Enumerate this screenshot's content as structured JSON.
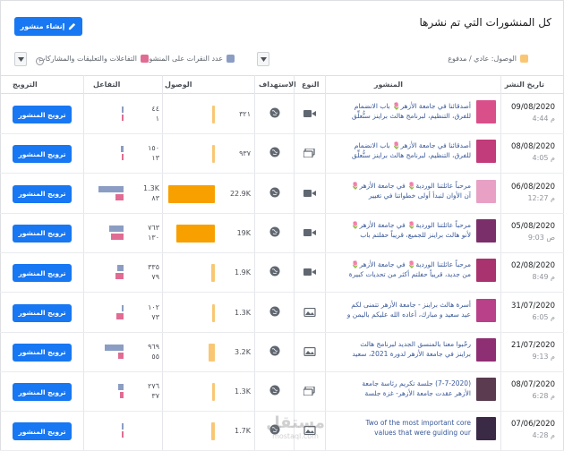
{
  "header": {
    "title": "كل المنشورات التي تم نشرها",
    "create_button": "إنشاء منشور"
  },
  "legend": {
    "reach_label": "الوصول: عادي / مدفوع",
    "clicks_label": "عدد النقرات على المنشور",
    "reactions_label": "التفاعلات والتعليقات والمشاركات",
    "reach_color": "#f7b928",
    "clicks_color": "#8b9dc3",
    "reactions_color": "#e06c93"
  },
  "columns": {
    "date": "تاريخ النشر",
    "post": "المنشور",
    "type": "النوع",
    "targeting": "الاستهداف",
    "reach": "الوصول",
    "engagement": "التفاعل",
    "promote": "الترويج"
  },
  "rows": [
    {
      "date": "09/08/2020",
      "time": "4:44 م",
      "text": "أصدقائنا في جامعة الأزهر🌷 باب الانضمام للفرق، التنظيم، لبرنامج هالث براينز سنُّعلِّق",
      "type": "video",
      "reach": "٣٢١",
      "reach_value": 321,
      "paid_value": 0,
      "clicks": "٤٤",
      "reactions": "١",
      "clicks_value": 44,
      "reactions_value": 1,
      "thumb_color": "#d94f8a",
      "promote": "ترويج المنشور"
    },
    {
      "date": "08/08/2020",
      "time": "4:05 م",
      "text": "أصدقائنا في جامعة الأزهر🌷 باب الانضمام للفرق، التنظيم، لبرنامج هالث براينز سنُّعلِّق",
      "type": "album",
      "reach": "٩٣٧",
      "reach_value": 937,
      "paid_value": 0,
      "clicks": "١٥٠",
      "reactions": "١٣",
      "clicks_value": 150,
      "reactions_value": 13,
      "thumb_color": "#c23b7a",
      "promote": "ترويج المنشور"
    },
    {
      "date": "06/08/2020",
      "time": "12:27 م",
      "text": "مرحباً عائلتنا الوردية🌷 في جامعة الأزهر🌷 آن الأوان لنبدأ أولى خطواتنا في تغيير المجتمع نحو",
      "type": "video",
      "reach": "22.9K",
      "reach_value": 22900,
      "paid_value": 0,
      "clicks": "1.3K",
      "reactions": "٨٣",
      "clicks_value": 1300,
      "reactions_value": 83,
      "thumb_color": "#e8a1c4",
      "promote": "ترويج المنشور"
    },
    {
      "date": "05/08/2020",
      "time": "9:03 ص",
      "text": "مرحباً عائلتنا الوردية🌷 في جامعة الأزهر🌷 لأنو هالث براينز للجميع، قريباً حفلتم باب الانضمام",
      "type": "video",
      "reach": "19K",
      "reach_value": 19000,
      "paid_value": 0,
      "clicks": "٧٦٣",
      "reactions": "١٣٠",
      "clicks_value": 763,
      "reactions_value": 130,
      "thumb_color": "#7a2f6b",
      "promote": "ترويج المنشور"
    },
    {
      "date": "02/08/2020",
      "time": "8:49 م",
      "text": "مرحباً عائلتنا الوردية🌷 في جامعة الأزهر🌷 من جديد، قريباً حفلتم أكثر من تحديات كبيرة",
      "type": "video",
      "reach": "1.9K",
      "reach_value": 1900,
      "paid_value": 0,
      "clicks": "٣٣٥",
      "reactions": "٧٩",
      "clicks_value": 335,
      "reactions_value": 79,
      "thumb_color": "#a8336f",
      "promote": "ترويج المنشور"
    },
    {
      "date": "31/07/2020",
      "time": "6:05 م",
      "text": "أسرة هالث براينز - جامعة الأزهر تتمنى لكم عيد سعيد و مبارك، أعاده الله عليكم باليمن و البركات،",
      "type": "image",
      "reach": "1.3K",
      "reach_value": 1300,
      "paid_value": 0,
      "clicks": "١٠٢",
      "reactions": "٧٣",
      "clicks_value": 102,
      "reactions_value": 73,
      "thumb_color": "#b8418a",
      "promote": "ترويج المنشور"
    },
    {
      "date": "21/07/2020",
      "time": "9:13 م",
      "text": "رحّبوا معنا بالمنسق الجديد لبرنامج هالث براينز في جامعة الأزهر لدورة 2021، سعيد عبد",
      "type": "image",
      "reach": "3.2K",
      "reach_value": 3200,
      "paid_value": 0,
      "clicks": "٩٦٩",
      "reactions": "٥٥",
      "clicks_value": 969,
      "reactions_value": 55,
      "thumb_color": "#8e2f73",
      "promote": "ترويج المنشور"
    },
    {
      "date": "08/07/2020",
      "time": "6:28 م",
      "text": "(7-7-2020) جلسة تكريم رئاسة جامعة الأزهر عقدت جامعة الأزهر- غزة جلسة تكريمية لإدارة",
      "type": "album",
      "reach": "1.3K",
      "reach_value": 1300,
      "paid_value": 0,
      "clicks": "٢٧٦",
      "reactions": "٣٧",
      "clicks_value": 276,
      "reactions_value": 37,
      "thumb_color": "#5a3b4f",
      "promote": "ترويج المنشور"
    },
    {
      "date": "07/06/2020",
      "time": "4:28 م",
      "text": "Two of the most important core values that were guiding our",
      "type": "image",
      "reach": "1.7K",
      "reach_value": 1700,
      "paid_value": 0,
      "clicks": "",
      "reactions": "",
      "clicks_value": 0,
      "reactions_value": 0,
      "thumb_color": "#3b2a45",
      "promote": "ترويج المنشور"
    }
  ],
  "watermark": {
    "text": "مستقل",
    "sub": "mostaql.com"
  }
}
